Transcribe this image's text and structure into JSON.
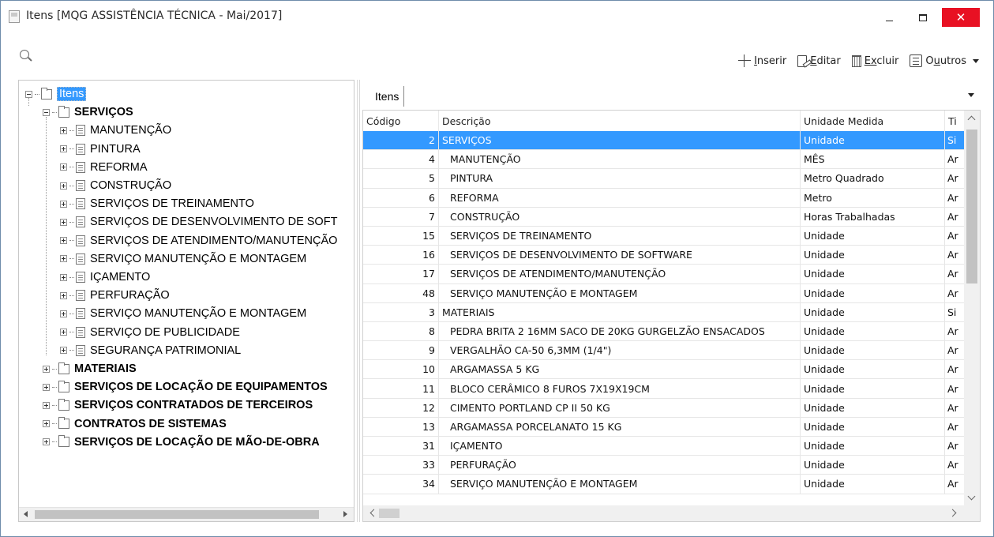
{
  "window": {
    "title": "Itens [MQG ASSISTÊNCIA TÉCNICA - Mai/2017]",
    "close_glyph": "✕"
  },
  "toolbar": {
    "insert_label": "nserir",
    "insert_mnemonic": "I",
    "edit_label": "ditar",
    "edit_mnemonic": "E",
    "delete_label": "cluir",
    "delete_mnemonic": "Ex",
    "delete_prefix": "",
    "others_prefix": "O",
    "others_label": "utros",
    "others_mnemonic": "u"
  },
  "tree": {
    "root": "Itens",
    "groups": [
      {
        "label": "SERVIÇOS",
        "expanded": true
      },
      {
        "label": "MATERIAIS"
      },
      {
        "label": "SERVIÇOS DE LOCAÇÃO DE EQUIPAMENTOS"
      },
      {
        "label": "SERVIÇOS CONTRATADOS DE TERCEIROS"
      },
      {
        "label": "CONTRATOS DE SISTEMAS"
      },
      {
        "label": "SERVIÇOS DE LOCAÇÃO DE MÃO-DE-OBRA"
      }
    ],
    "children": [
      "MANUTENÇÃO",
      "PINTURA",
      "REFORMA",
      "CONSTRUÇÃO",
      "SERVIÇOS DE TREINAMENTO",
      "SERVIÇOS DE DESENVOLVIMENTO DE SOFT",
      "SERVIÇOS DE ATENDIMENTO/MANUTENÇÃO",
      "SERVIÇO MANUTENÇÃO E MONTAGEM",
      "IÇAMENTO",
      "PERFURAÇÃO",
      "SERVIÇO MANUTENÇÃO E MONTAGEM",
      "SERVIÇO DE PUBLICIDADE",
      "SEGURANÇA PATRIMONIAL"
    ]
  },
  "tabs": {
    "active": "Itens"
  },
  "grid": {
    "headers": {
      "code": "Código",
      "description": "Descrição",
      "unit": "Unidade Medida",
      "type": "Ti"
    },
    "rows": [
      {
        "code": "2",
        "description": "SERVIÇOS",
        "unit": "Unidade",
        "type": "Si",
        "child": false,
        "selected": true
      },
      {
        "code": "4",
        "description": "MANUTENÇÃO",
        "unit": "MÊS",
        "type": "Ar",
        "child": true
      },
      {
        "code": "5",
        "description": "PINTURA",
        "unit": "Metro Quadrado",
        "type": "Ar",
        "child": true
      },
      {
        "code": "6",
        "description": "REFORMA",
        "unit": "Metro",
        "type": "Ar",
        "child": true
      },
      {
        "code": "7",
        "description": "CONSTRUÇÃO",
        "unit": "Horas Trabalhadas",
        "type": "Ar",
        "child": true
      },
      {
        "code": "15",
        "description": "SERVIÇOS DE TREINAMENTO",
        "unit": "Unidade",
        "type": "Ar",
        "child": true
      },
      {
        "code": "16",
        "description": "SERVIÇOS DE DESENVOLVIMENTO DE SOFTWARE",
        "unit": "Unidade",
        "type": "Ar",
        "child": true
      },
      {
        "code": "17",
        "description": "SERVIÇOS DE ATENDIMENTO/MANUTENÇÃO",
        "unit": "Unidade",
        "type": "Ar",
        "child": true
      },
      {
        "code": "48",
        "description": "SERVIÇO MANUTENÇÃO E MONTAGEM",
        "unit": "Unidade",
        "type": "Ar",
        "child": true
      },
      {
        "code": "3",
        "description": "MATERIAIS",
        "unit": "Unidade",
        "type": "Si",
        "child": false
      },
      {
        "code": "8",
        "description": "PEDRA BRITA 2 16MM SACO DE 20KG GURGELZÃO ENSACADOS",
        "unit": "Unidade",
        "type": "Ar",
        "child": true
      },
      {
        "code": "9",
        "description": "VERGALHÃO CA-50 6,3MM (1/4\")",
        "unit": "Unidade",
        "type": "Ar",
        "child": true
      },
      {
        "code": "10",
        "description": "ARGAMASSA 5 KG",
        "unit": "Unidade",
        "type": "Ar",
        "child": true
      },
      {
        "code": "11",
        "description": "BLOCO CERÂMICO 8 FUROS 7X19X19CM",
        "unit": "Unidade",
        "type": "Ar",
        "child": true
      },
      {
        "code": "12",
        "description": "CIMENTO PORTLAND CP II 50 KG",
        "unit": "Unidade",
        "type": "Ar",
        "child": true
      },
      {
        "code": "13",
        "description": "ARGAMASSA PORCELANATO 15 KG",
        "unit": "Unidade",
        "type": "Ar",
        "child": true
      },
      {
        "code": "31",
        "description": "IÇAMENTO",
        "unit": "Unidade",
        "type": "Ar",
        "child": true
      },
      {
        "code": "33",
        "description": "PERFURAÇÃO",
        "unit": "Unidade",
        "type": "Ar",
        "child": true
      },
      {
        "code": "34",
        "description": "SERVIÇO MANUTENÇÃO E MONTAGEM",
        "unit": "Unidade",
        "type": "Ar",
        "child": true
      }
    ]
  },
  "colors": {
    "selection": "#3399ff",
    "close_button": "#e81123"
  }
}
